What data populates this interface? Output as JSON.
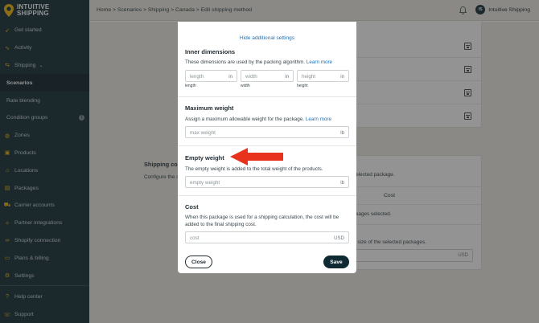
{
  "brand": {
    "line1": "INTUITIVE",
    "line2": "SHIPPING"
  },
  "breadcrumb": "Home > Scenarios > Shipping > Canada > Edit shipping method",
  "user": {
    "initials": "IS",
    "name": "Intuitive Shipping"
  },
  "sidebar": {
    "items": [
      {
        "label": "Get started",
        "icon": "rocket-icon"
      },
      {
        "label": "Activity",
        "icon": "activity-icon"
      },
      {
        "label": "Shipping",
        "icon": "shipping-icon",
        "chevron": "chevron-down-icon"
      },
      {
        "label": "Scenarios",
        "active": true
      },
      {
        "label": "Rate blending"
      },
      {
        "label": "Condition groups",
        "badge": "!"
      },
      {
        "label": "Zones",
        "icon": "globe-icon"
      },
      {
        "label": "Products",
        "icon": "box-icon"
      },
      {
        "label": "Locations",
        "icon": "location-icon"
      },
      {
        "label": "Packages",
        "icon": "package-icon"
      },
      {
        "label": "Carrier accounts",
        "icon": "truck-icon"
      },
      {
        "label": "Partner integrations",
        "icon": "handshake-icon"
      },
      {
        "label": "Shopify connection",
        "icon": "link-icon"
      },
      {
        "label": "Plans & billing",
        "icon": "credit-card-icon"
      },
      {
        "label": "Settings",
        "icon": "gear-icon"
      }
    ],
    "footer": [
      {
        "label": "Help center",
        "icon": "help-icon"
      },
      {
        "label": "Support",
        "icon": "support-icon"
      }
    ]
  },
  "background": {
    "shipping_cost_title": "Shipping co",
    "shipping_cost_desc": "Configure the s the shipping co",
    "selected_package_text": "selected package.",
    "cost_header": "Cost",
    "packages_selected_text": "ckages selected.",
    "size_text": "e size of the selected packages.",
    "usd": "USD"
  },
  "modal": {
    "hide_settings_link": "Hide additional settings",
    "inner": {
      "title": "Inner dimensions",
      "desc": "These dimensions are used by the packing algorithm.",
      "learn_more": "Learn more",
      "fields": [
        {
          "placeholder": "length",
          "unit": "in",
          "label": "length"
        },
        {
          "placeholder": "width",
          "unit": "in",
          "label": "width"
        },
        {
          "placeholder": "height",
          "unit": "in",
          "label": "height"
        }
      ]
    },
    "max_weight": {
      "title": "Maximum weight",
      "desc": "Assign a maximum allowable weight for the package.",
      "learn_more": "Learn more",
      "placeholder": "max weight",
      "unit": "lb"
    },
    "empty_weight": {
      "title": "Empty weight",
      "desc": "The empty weight is added to the total weight of the products.",
      "placeholder": "empty weight",
      "unit": "lb"
    },
    "cost": {
      "title": "Cost",
      "desc": "When this package is used for a shipping calculation, the cost will be added to the final shipping cost.",
      "placeholder": "cost",
      "unit": "USD"
    },
    "close_label": "Close",
    "save_label": "Save"
  },
  "colors": {
    "sidebar_bg": "#0f2a33",
    "accent": "#f2b400",
    "link": "#1d6fb8",
    "arrow": "#e8321e"
  }
}
